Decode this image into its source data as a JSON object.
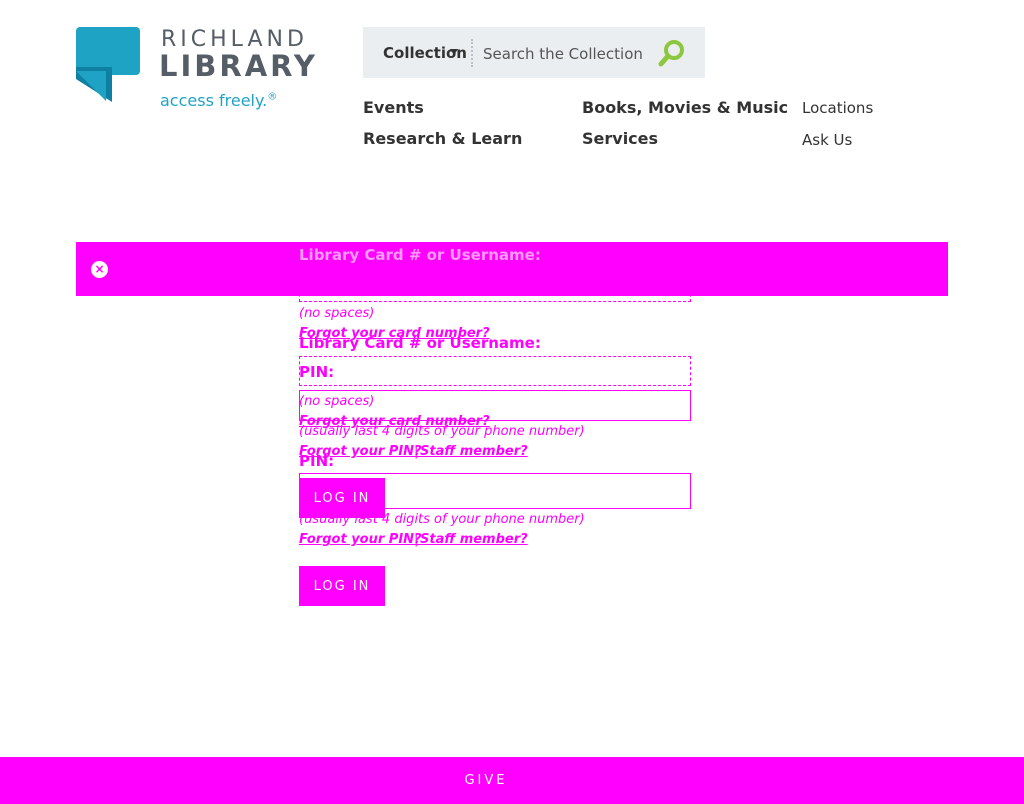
{
  "brand": {
    "name_line1": "RICHLAND",
    "name_line2": "LIBRARY",
    "tagline": "access freely.",
    "tagline_mark": "®",
    "colors": {
      "primary": "#1fa3c4",
      "dark": "#555d66",
      "search_go": "#8dc63f"
    }
  },
  "search": {
    "scope_label": "Collection",
    "placeholder": "Search the Collection",
    "icon": "search-icon"
  },
  "nav": {
    "main": [
      "Events",
      "Books, Movies & Music",
      "Research & Learn",
      "Services"
    ],
    "secondary": [
      "Locations",
      "Ask Us"
    ]
  },
  "alert": {
    "color": "#ff00ff",
    "close_icon": "close-icon"
  },
  "login": {
    "card_label": "Library Card # or Username:",
    "card_hint": "(no spaces)",
    "card_help": "Forgot your card number?",
    "pin_label": "PIN:",
    "pin_hint": "(usually last 4 digits of your phone number)",
    "forgot_pin": "Forgot your PIN?",
    "separator": "|",
    "staff": "Staff member?",
    "submit": "LOG IN"
  },
  "footer": {
    "give": "GIVE",
    "color": "#ff00ff"
  }
}
